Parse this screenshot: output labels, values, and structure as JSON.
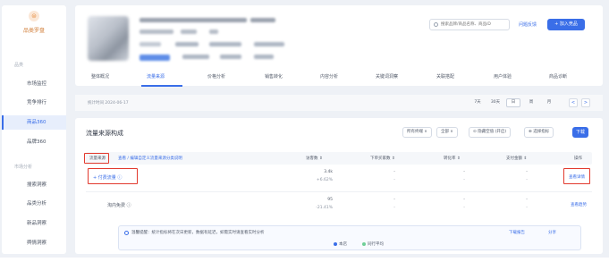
{
  "colors": {
    "accent": "#3a6ee8",
    "brand": "#d2803c",
    "highlight": "#e23a2e"
  },
  "sidebar": {
    "brand_icon": "⊜",
    "brand_label": "品类罗盘",
    "groups": [
      "品类",
      "市场分析"
    ],
    "items": [
      {
        "label": "市场监控"
      },
      {
        "label": "竞争排行"
      },
      {
        "label": "商品360"
      },
      {
        "label": "品牌360"
      },
      {
        "label": "搜索洞察"
      },
      {
        "label": "品类分析"
      },
      {
        "label": "新品洞察"
      },
      {
        "label": "舆情洞察"
      }
    ]
  },
  "header": {
    "search_placeholder": "搜索品牌/商品名称、商品ID",
    "link_label": "问题反馈",
    "button_label": "+ 加入竞品"
  },
  "tabs": [
    {
      "label": "整体概况"
    },
    {
      "label": "流量来源"
    },
    {
      "label": "价格分析"
    },
    {
      "label": "销售转化"
    },
    {
      "label": "内容分析"
    },
    {
      "label": "关键词洞察"
    },
    {
      "label": "关联搭配"
    },
    {
      "label": "用户体验"
    },
    {
      "label": "商品诊断"
    }
  ],
  "filter": {
    "date": "统计时间 2024-06-17",
    "periods": [
      "7天",
      "30天",
      "日",
      "周",
      "月"
    ],
    "pager_prev": "<",
    "pager_next": ">"
  },
  "content": {
    "title": "流量来源构成",
    "ctrl_terminal": "所有终端 ∨",
    "ctrl_compare": "全部 ∨",
    "ctrl_toggle": "⊙ 隐藏空值 (开启)",
    "ctrl_select": "⊕ 选择指标",
    "ctrl_blue": "下载",
    "columns": {
      "source": "流量来源",
      "link": "查看 / 编辑自定义流量来源分类说明",
      "visitors": "访客数 ⇕",
      "buyers": "下单买家数 ⇕",
      "conversion": "转化率 ⇕",
      "amount": "支付金额 ⇕",
      "action": "操作"
    },
    "rows": [
      {
        "label": "+  付费流量 ⓘ",
        "visitors": "3.4k",
        "visitors_change": "+6.62%",
        "buyers": "-",
        "buyers_sub": "-",
        "conversion": "-",
        "conversion_sub": "-",
        "amount": "-",
        "amount_sub": "-",
        "action": "查看详情"
      },
      {
        "label": "淘内免费 ⓘ",
        "visitors": "95",
        "visitors_change": "-21.41%",
        "buyers": "-",
        "buyers_sub": "-",
        "conversion": "-",
        "conversion_sub": "-",
        "amount": "-",
        "amount_sub": "-",
        "action": "查看趋势"
      }
    ],
    "notice": {
      "text": "温馨提醒：统计指标将在次日更新，数据有延迟，如需实时请查看实时分析",
      "right1": "下载报告",
      "right2": "分享",
      "legend1": "本店",
      "legend2": "同行平均"
    }
  }
}
